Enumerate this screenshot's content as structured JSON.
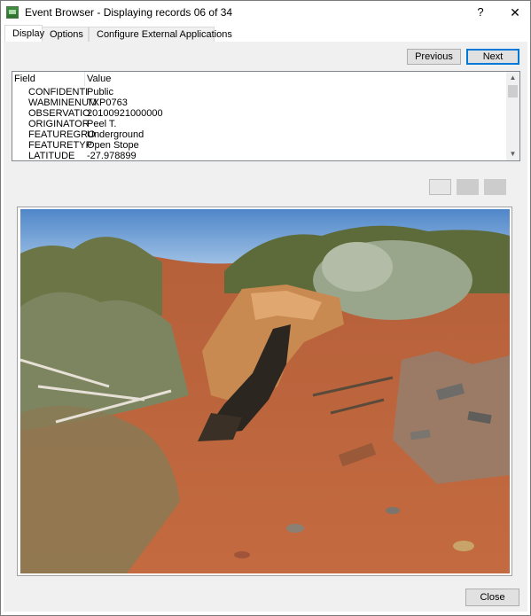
{
  "window": {
    "title": "Event Browser - Displaying records 06 of 34",
    "help_label": "?",
    "close_label": "✕"
  },
  "tabs": [
    {
      "label": "Display",
      "active": true
    },
    {
      "label": "Options",
      "active": false
    },
    {
      "label": "Configure External Applications",
      "active": false
    }
  ],
  "nav": {
    "previous_label": "Previous",
    "next_label": "Next"
  },
  "grid": {
    "columns": [
      "Field",
      "Value"
    ],
    "rows": [
      {
        "field": "CONFIDENTI",
        "value": "Public"
      },
      {
        "field": "WABMINENUM",
        "value": "TXP0763"
      },
      {
        "field": "OBSERVATIO",
        "value": "20100921000000"
      },
      {
        "field": "ORIGINATOR",
        "value": "Peel T."
      },
      {
        "field": "FEATUREGRO",
        "value": "Underground"
      },
      {
        "field": "FEATURETYP",
        "value": "Open Stope"
      },
      {
        "field": "LATITUDE",
        "value": "-27.978899"
      }
    ],
    "scroll_up": "▲",
    "scroll_down": "▼"
  },
  "photo": {
    "subject": "open stope trench in red earth with rocks and scrub"
  },
  "footer": {
    "close_label": "Close"
  }
}
